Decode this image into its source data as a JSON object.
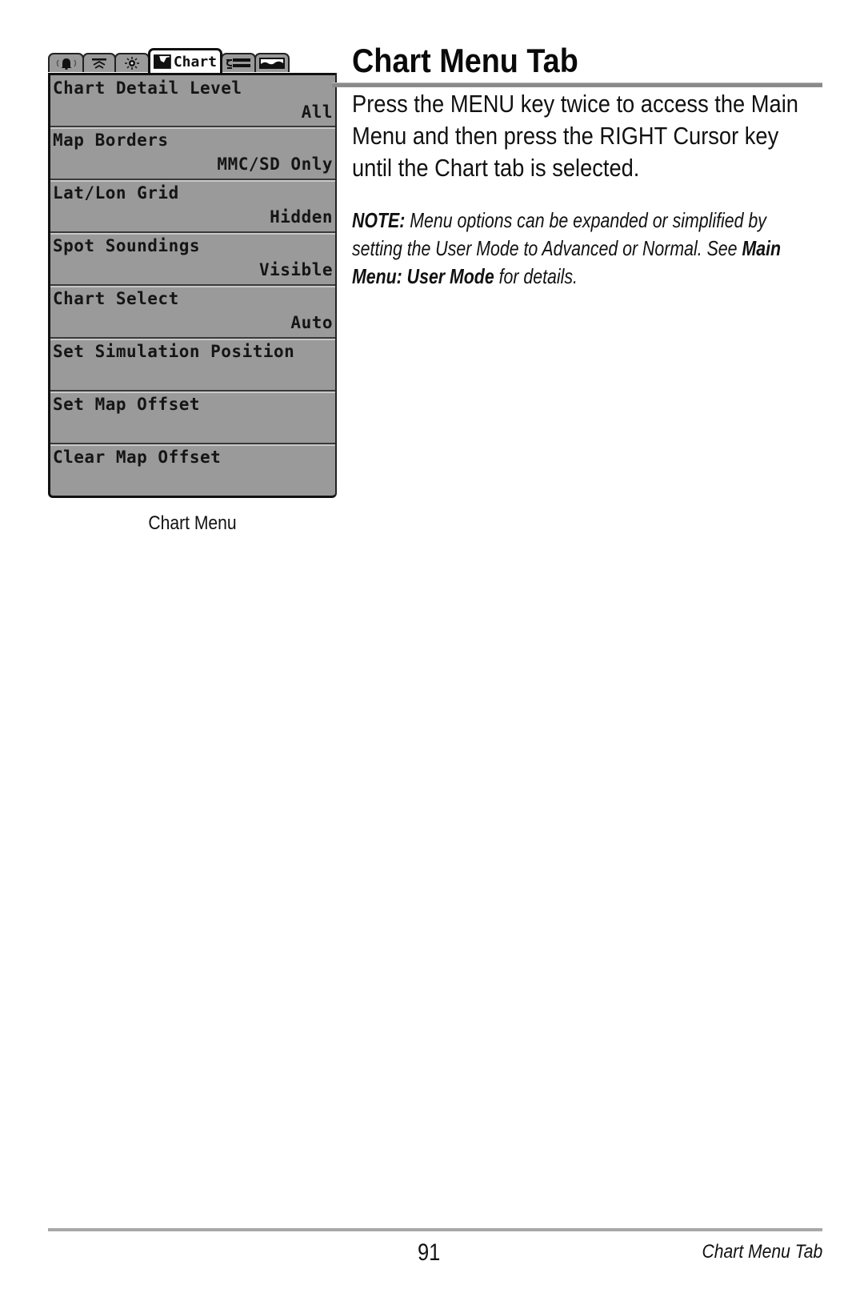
{
  "page": {
    "title": "Chart Menu Tab",
    "intro": "Press the MENU key twice to access the Main Menu and then press the RIGHT Cursor key until the Chart tab is selected.",
    "note": {
      "label": "NOTE:",
      "text": " Menu options can be expanded or simplified by setting the User Mode to Advanced or Normal. See ",
      "link": "Main Menu: User Mode",
      "suffix": " for details."
    }
  },
  "menu": {
    "tabs": [
      {
        "icon": "alarm-bell-icon"
      },
      {
        "icon": "sonar-icon"
      },
      {
        "icon": "setup-sun-icon"
      },
      {
        "icon": "chart-map-icon",
        "label": "Chart",
        "active": true
      },
      {
        "icon": "navigation-icon"
      },
      {
        "icon": "views-icon"
      }
    ],
    "items": [
      {
        "label": "Chart Detail Level",
        "value": "All"
      },
      {
        "label": "Map Borders",
        "value": "MMC/SD Only"
      },
      {
        "label": "Lat/Lon Grid",
        "value": "Hidden"
      },
      {
        "label": "Spot Soundings",
        "value": "Visible"
      },
      {
        "label": "Chart Select",
        "value": "Auto"
      },
      {
        "label": "Set Simulation Position",
        "value": ""
      },
      {
        "label": "Set Map Offset",
        "value": ""
      },
      {
        "label": "Clear Map Offset",
        "value": ""
      }
    ],
    "caption": "Chart Menu"
  },
  "footer": {
    "page_number": "91",
    "section": "Chart Menu Tab"
  },
  "colors": {
    "menu_background": "#9a9a9a",
    "rule": "#8a8a8a"
  }
}
